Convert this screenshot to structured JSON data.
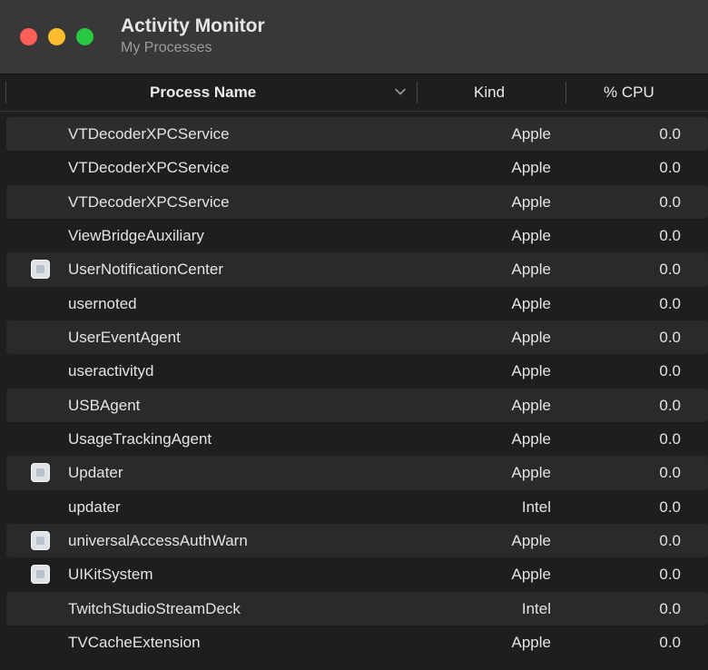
{
  "window": {
    "title": "Activity Monitor",
    "subtitle": "My Processes",
    "colors": {
      "close": "#fe5f57",
      "minimize": "#febc2e",
      "maximize": "#28c840"
    }
  },
  "columns": {
    "name": "Process Name",
    "kind": "Kind",
    "cpu": "% CPU"
  },
  "processes": [
    {
      "name": "VTDecoderXPCService",
      "kind": "Apple",
      "cpu": "0.0",
      "icon": false
    },
    {
      "name": "VTDecoderXPCService",
      "kind": "Apple",
      "cpu": "0.0",
      "icon": false
    },
    {
      "name": "VTDecoderXPCService",
      "kind": "Apple",
      "cpu": "0.0",
      "icon": false
    },
    {
      "name": "ViewBridgeAuxiliary",
      "kind": "Apple",
      "cpu": "0.0",
      "icon": false
    },
    {
      "name": "UserNotificationCenter",
      "kind": "Apple",
      "cpu": "0.0",
      "icon": true
    },
    {
      "name": "usernoted",
      "kind": "Apple",
      "cpu": "0.0",
      "icon": false
    },
    {
      "name": "UserEventAgent",
      "kind": "Apple",
      "cpu": "0.0",
      "icon": false
    },
    {
      "name": "useractivityd",
      "kind": "Apple",
      "cpu": "0.0",
      "icon": false
    },
    {
      "name": "USBAgent",
      "kind": "Apple",
      "cpu": "0.0",
      "icon": false
    },
    {
      "name": "UsageTrackingAgent",
      "kind": "Apple",
      "cpu": "0.0",
      "icon": false
    },
    {
      "name": "Updater",
      "kind": "Apple",
      "cpu": "0.0",
      "icon": true
    },
    {
      "name": "updater",
      "kind": "Intel",
      "cpu": "0.0",
      "icon": false
    },
    {
      "name": "universalAccessAuthWarn",
      "kind": "Apple",
      "cpu": "0.0",
      "icon": true
    },
    {
      "name": "UIKitSystem",
      "kind": "Apple",
      "cpu": "0.0",
      "icon": true
    },
    {
      "name": "TwitchStudioStreamDeck",
      "kind": "Intel",
      "cpu": "0.0",
      "icon": false
    },
    {
      "name": "TVCacheExtension",
      "kind": "Apple",
      "cpu": "0.0",
      "icon": false
    }
  ]
}
